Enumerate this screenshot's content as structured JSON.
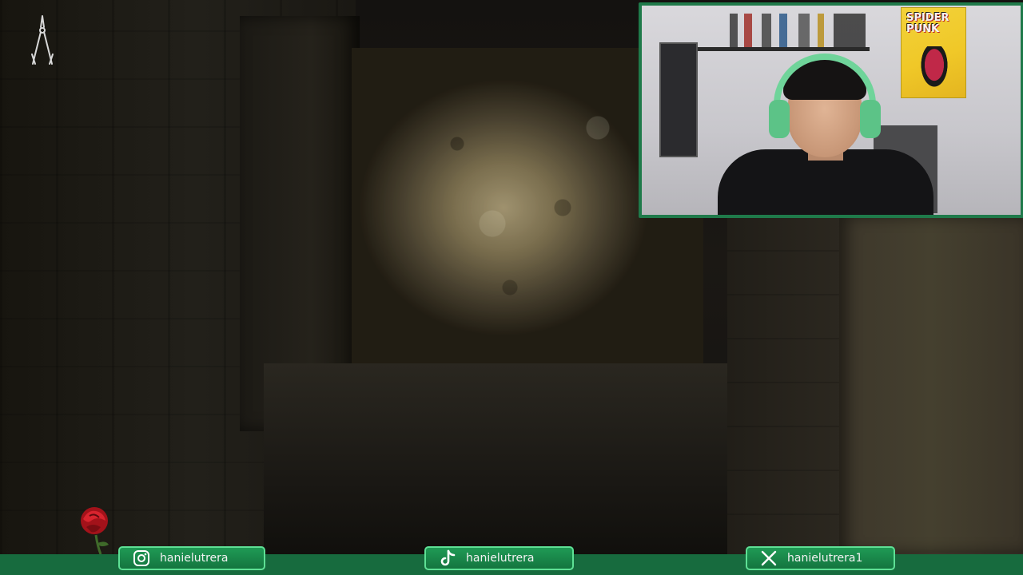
{
  "overlay": {
    "socials": [
      {
        "platform": "instagram",
        "icon": "instagram-icon",
        "handle": "hanielutrera"
      },
      {
        "platform": "tiktok",
        "icon": "tiktok-icon",
        "handle": "hanielutrera"
      },
      {
        "platform": "x",
        "icon": "x-icon",
        "handle": "hanielutrera1"
      }
    ],
    "accent_color": "#1f7a4a",
    "pill_border_color": "#5ee095"
  },
  "webcam": {
    "poster_text": "SPIDER PUNK"
  },
  "hud": {
    "held_item_icon": "bolt-cutters-icon",
    "health_icon": "rose-icon"
  }
}
